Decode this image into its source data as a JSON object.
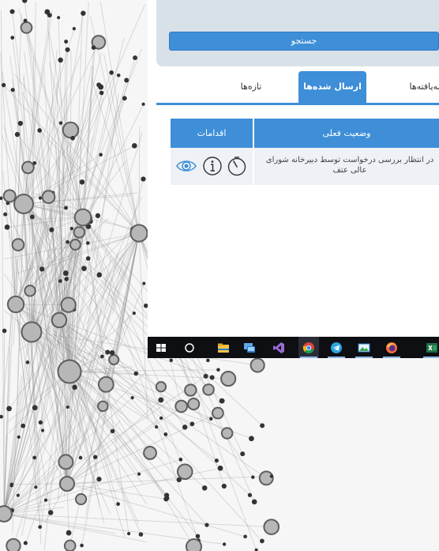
{
  "search": {
    "button_label": "جستجو"
  },
  "tabs": {
    "new_label": "تازه‌ها",
    "sent_label": "ارسال شده‌ها",
    "finished_label": "خاتمه‌یافته‌ها",
    "active": "sent"
  },
  "table": {
    "headers": {
      "status": "وضعیت فعلی",
      "actions": "اقدامات"
    },
    "rows": [
      {
        "status": "در انتظار بررسی درخواست توسط دبیرخانه شورای عالی عتف",
        "actions": [
          "timer-icon",
          "info-icon",
          "eye-icon"
        ]
      }
    ]
  },
  "taskbar": {
    "apps": [
      "windows-start-icon",
      "cortana-search-icon",
      "file-explorer-icon",
      "remote-desktop-icon",
      "visual-studio-icon",
      "chrome-icon",
      "telegram-icon",
      "image-viewer-icon",
      "firefox-icon",
      "excel-icon"
    ]
  },
  "colors": {
    "accent": "#3e8ed8",
    "panel": "#d9e1e8",
    "row": "#eef1f5",
    "taskbar": "#0d0f13"
  }
}
